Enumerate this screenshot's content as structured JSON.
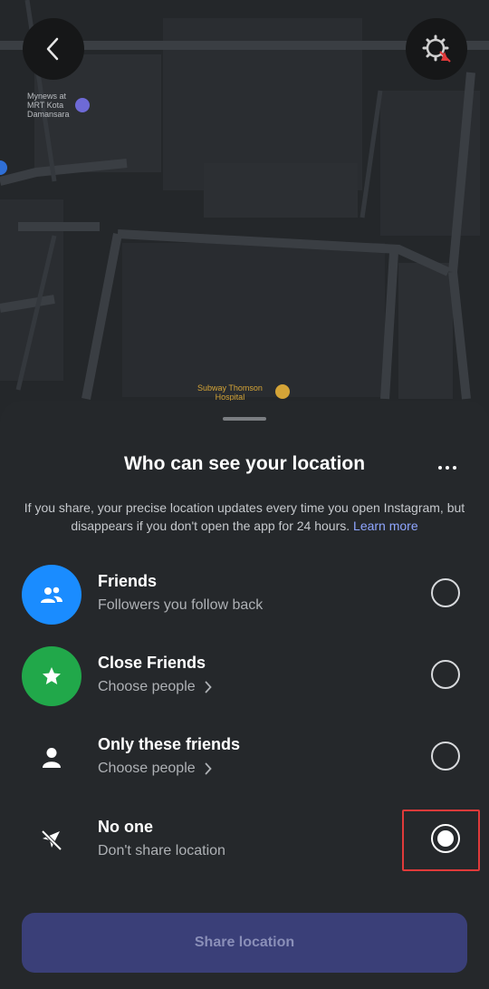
{
  "map": {
    "labels": {
      "mynews": "Mynews at\nMRT Kota\nDamansara",
      "subway": "Subway Thomson\nHospital"
    }
  },
  "sheet": {
    "title": "Who can see your location",
    "description": "If you share, your precise location updates every time you open Instagram, but disappears if you don't open the app for 24 hours.",
    "learn_more": "Learn more",
    "options": [
      {
        "title": "Friends",
        "subtitle": "Followers you follow back",
        "icon": "people-icon",
        "color": "#1a8cff",
        "selected": false
      },
      {
        "title": "Close Friends",
        "subtitle": "Choose people",
        "icon": "star-icon",
        "color": "#21a84a",
        "selected": false
      },
      {
        "title": "Only these friends",
        "subtitle": "Choose people",
        "icon": "person-icon",
        "color": null,
        "selected": false
      },
      {
        "title": "No one",
        "subtitle": "Don't share location",
        "icon": "location-off-icon",
        "color": null,
        "selected": true
      }
    ],
    "share_button": "Share location"
  }
}
